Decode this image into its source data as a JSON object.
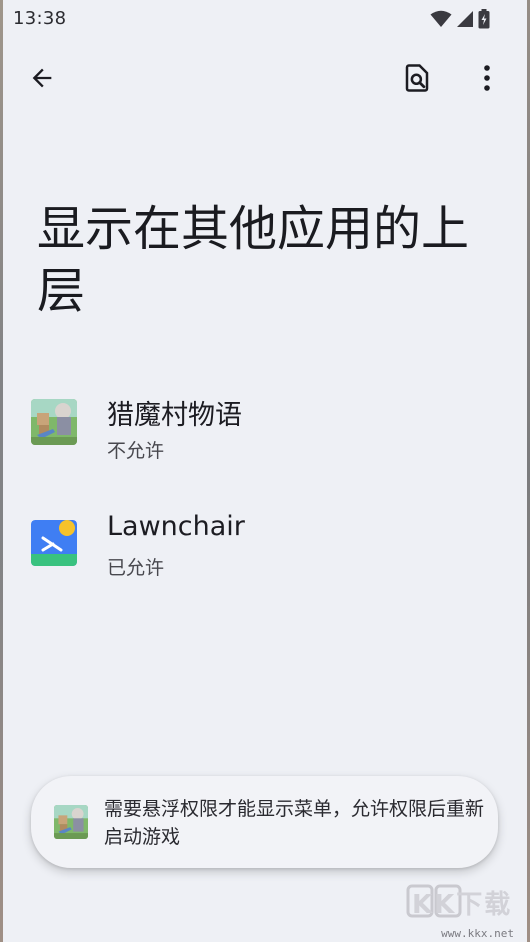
{
  "status_bar": {
    "time": "13:38",
    "icons": [
      "wifi-icon",
      "signal-icon",
      "battery-charging-icon"
    ]
  },
  "toolbar": {
    "back_icon": "arrow-back-icon",
    "search_icon": "search-in-page-icon",
    "more_icon": "more-vert-icon"
  },
  "page": {
    "title": "显示在其他应用的上层"
  },
  "apps": [
    {
      "name": "猎魔村物语",
      "status": "不允许",
      "icon": "game-app-icon"
    },
    {
      "name": "Lawnchair",
      "status": "已允许",
      "icon": "lawnchair-app-icon"
    }
  ],
  "toast": {
    "message": "需要悬浮权限才能显示菜单，允许权限后重新启动游戏",
    "icon": "game-app-icon"
  },
  "watermark": {
    "text": "KK下载",
    "url": "www.kkx.net"
  },
  "colors": {
    "background": "#eef0f5",
    "lawnchair_blue": "#3f7ef3",
    "lawnchair_green": "#39c27f",
    "lawnchair_yellow": "#f6c22a"
  }
}
